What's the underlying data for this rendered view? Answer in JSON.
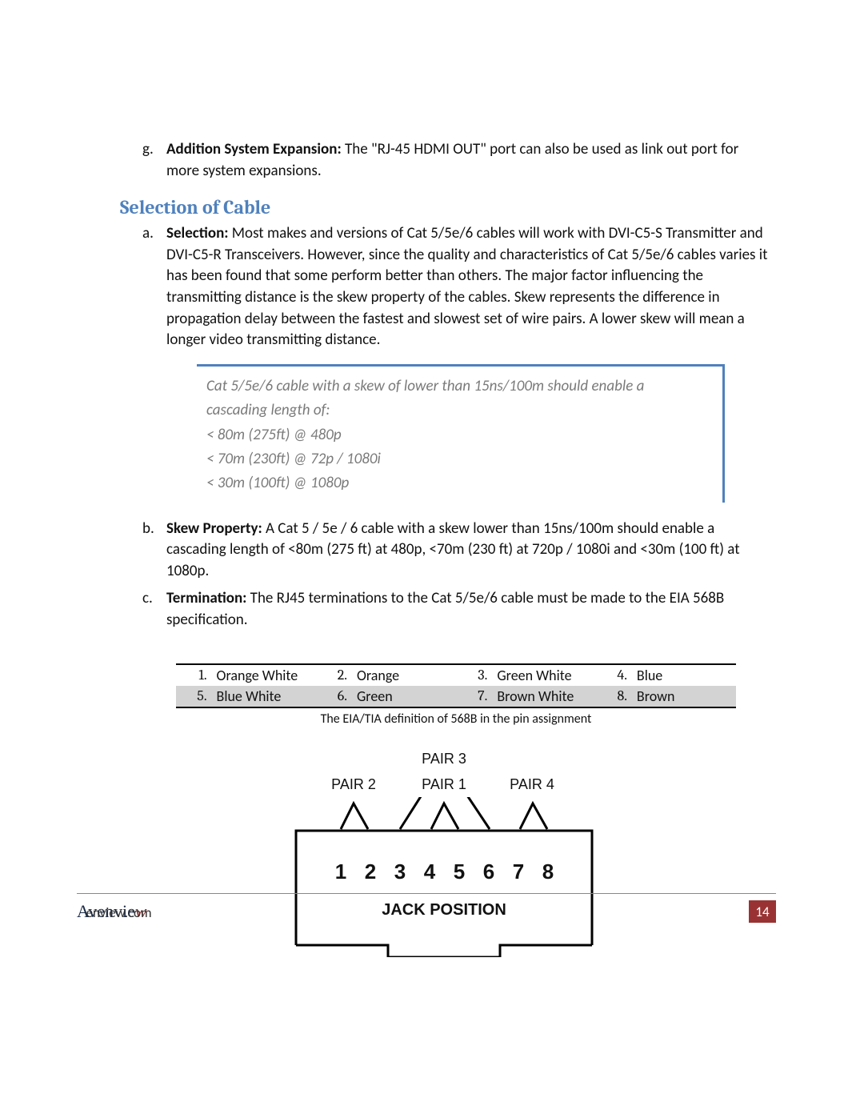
{
  "item_g": {
    "marker": "g.",
    "label": "Addition System Expansion:",
    "text": " The \"RJ-45 HDMI OUT\" port can also be used as link out port for more system expansions."
  },
  "heading": "Selection of Cable",
  "item_a": {
    "marker": "a.",
    "label": "Selection:",
    "text": " Most makes and versions of Cat 5/5e/6 cables will work with DVI-C5-S Transmitter and DVI-C5-R Transceivers. However, since the quality and characteristics of Cat 5/5e/6 cables varies it has been found that some perform better than others. The major factor influencing the transmitting distance is the skew property of the cables. Skew represents the difference in propagation delay between the fastest and slowest set of wire pairs. A lower skew will mean a longer video transmitting distance."
  },
  "callout": {
    "line1": "Cat 5/5e/6 cable with a skew of lower than 15ns/100m should enable a cascading length of:",
    "line2": "< 80m (275ft) @ 480p",
    "line3": "< 70m (230ft) @ 72p / 1080i",
    "line4": "< 30m (100ft) @ 1080p"
  },
  "item_b": {
    "marker": "b.",
    "label": "Skew Property:",
    "text": " A Cat 5 / 5e / 6 cable with a skew lower than 15ns/100m should enable a cascading length of <80m (275 ft) at 480p, <70m (230 ft) at 720p / 1080i and <30m (100 ft) at 1080p."
  },
  "item_c": {
    "marker": "c.",
    "label": "Termination:",
    "text": " The RJ45 terminations to the Cat 5/5e/6 cable must be made to the EIA 568B specification."
  },
  "pins": {
    "n1": "1.",
    "c1": "Orange White",
    "n2": "2.",
    "c2": "Orange",
    "n3": "3.",
    "c3": "Green White",
    "n4": "4.",
    "c4": "Blue",
    "n5": "5.",
    "c5": "Blue White",
    "n6": "6.",
    "c6": "Green",
    "n7": "7.",
    "c7": "Brown White",
    "n8": "8.",
    "c8": "Brown"
  },
  "table_caption": "The EIA/TIA definition of 568B in the pin assignment",
  "jack": {
    "pair1": "PAIR 1",
    "pair2": "PAIR 2",
    "pair3": "PAIR 3",
    "pair4": "PAIR 4",
    "p1": "1",
    "p2": "2",
    "p3": "3",
    "p4": "4",
    "p5": "5",
    "p6": "6",
    "p7": "7",
    "p8": "8",
    "title": "JACK POSITION"
  },
  "footer": {
    "brand_main": "Avenvie",
    "brand_accent": "w",
    "site": "enview.com",
    "page": "14"
  }
}
